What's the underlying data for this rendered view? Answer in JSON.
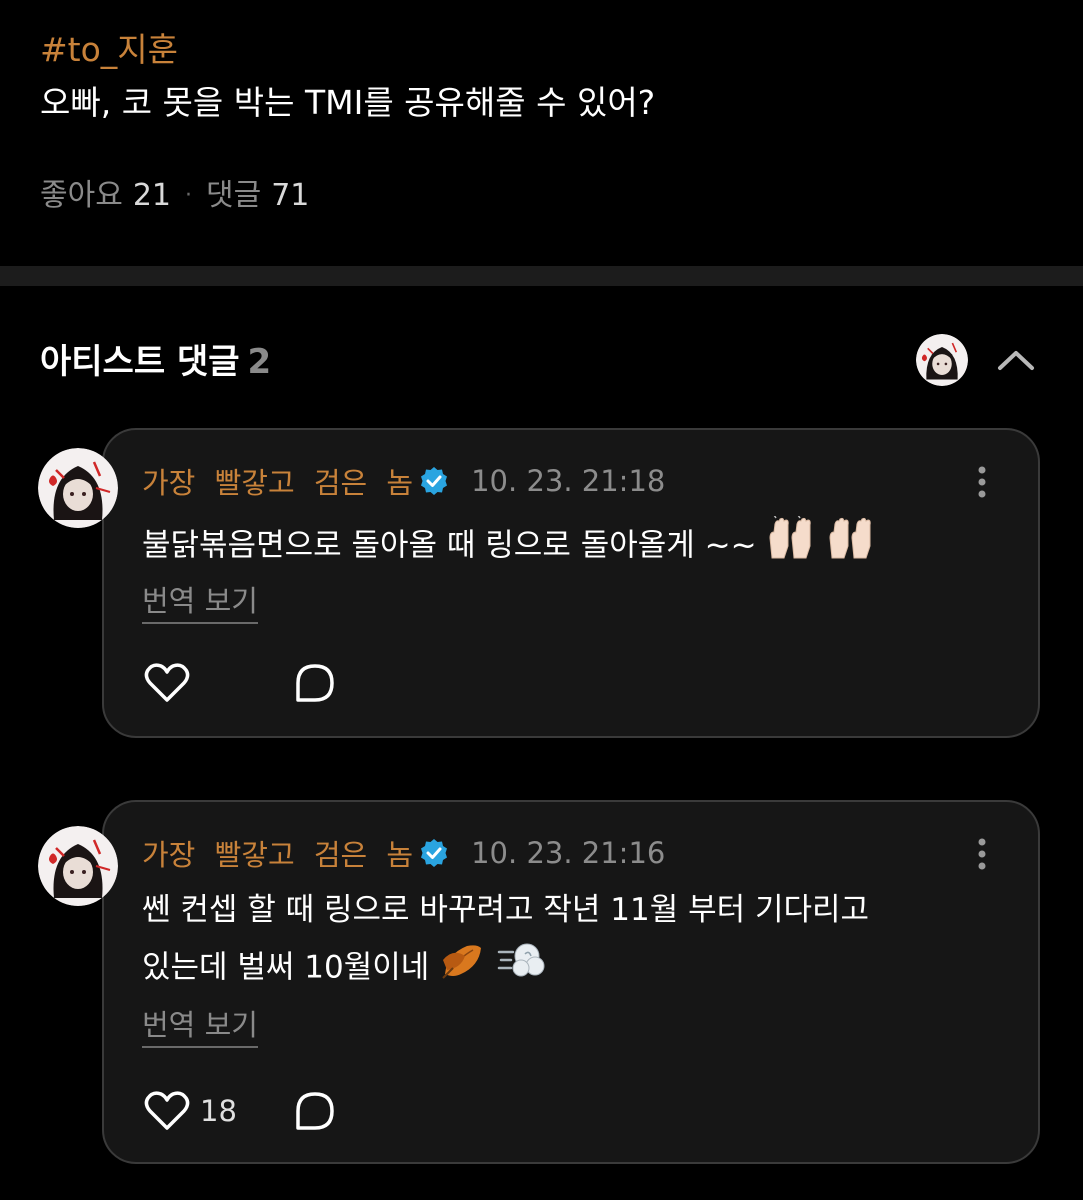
{
  "post": {
    "hashtag": "#to_지훈",
    "text": "오빠, 코 못을 박는 TMI를 공유해줄 수 있어?",
    "likes_label": "좋아요",
    "likes_count": "21",
    "separator": "·",
    "comments_label": "댓글",
    "comments_count": "71"
  },
  "section": {
    "title": "아티스트 댓글",
    "count": "2"
  },
  "comments": [
    {
      "author": "가장 빨갛고 검은 놈",
      "timestamp": "10. 23. 21:18",
      "text": "불닭볶음면으로 돌아올 때 링으로 돌아올게 ~~",
      "emoji": [
        "raised-hands-icon",
        "raised-hands-icon"
      ],
      "translate_label": "번역 보기",
      "like_count": ""
    },
    {
      "author": "가장 빨갛고 검은 놈",
      "timestamp": "10. 23. 21:16",
      "text_line1": "쎈 컨셉 할 때 링으로 바꾸려고 작년 11월 부터 기다리고",
      "text_line2": "있는데 벌써 10월이네",
      "emoji": [
        "fallen-leaf-icon",
        "dash-icon"
      ],
      "translate_label": "번역 보기",
      "like_count": "18"
    }
  ],
  "colors": {
    "accent": "#c8823a",
    "background": "#000000",
    "card": "#161616",
    "card_border": "#3a3a3a",
    "muted": "#8a8a8a",
    "verified": "#2aa4e0"
  }
}
